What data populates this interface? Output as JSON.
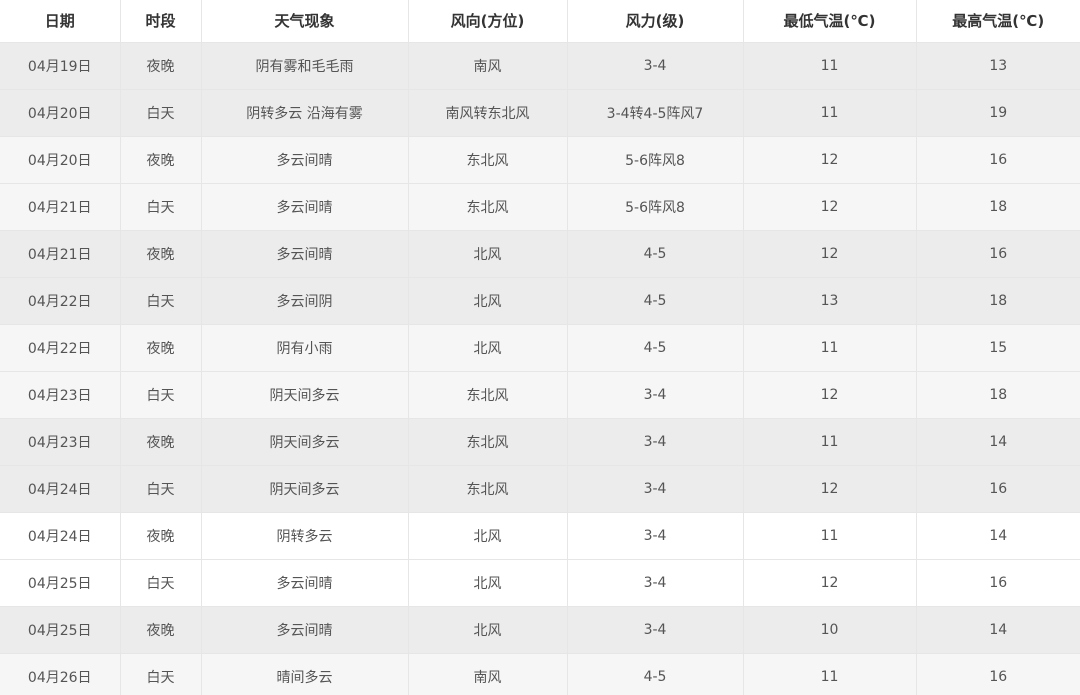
{
  "table": {
    "headers": [
      "日期",
      "时段",
      "天气现象",
      "风向(方位)",
      "风力(级)",
      "最低气温(℃)",
      "最高气温(℃)"
    ],
    "rows": [
      [
        "04月19日",
        "夜晚",
        "阴有雾和毛毛雨",
        "南风",
        "3-4",
        "11",
        "13"
      ],
      [
        "04月20日",
        "白天",
        "阴转多云 沿海有雾",
        "南风转东北风",
        "3-4转4-5阵风7",
        "11",
        "19"
      ],
      [
        "04月20日",
        "夜晚",
        "多云间晴",
        "东北风",
        "5-6阵风8",
        "12",
        "16"
      ],
      [
        "04月21日",
        "白天",
        "多云间晴",
        "东北风",
        "5-6阵风8",
        "12",
        "18"
      ],
      [
        "04月21日",
        "夜晚",
        "多云间晴",
        "北风",
        "4-5",
        "12",
        "16"
      ],
      [
        "04月22日",
        "白天",
        "多云间阴",
        "北风",
        "4-5",
        "13",
        "18"
      ],
      [
        "04月22日",
        "夜晚",
        "阴有小雨",
        "北风",
        "4-5",
        "11",
        "15"
      ],
      [
        "04月23日",
        "白天",
        "阴天间多云",
        "东北风",
        "3-4",
        "12",
        "18"
      ],
      [
        "04月23日",
        "夜晚",
        "阴天间多云",
        "东北风",
        "3-4",
        "11",
        "14"
      ],
      [
        "04月24日",
        "白天",
        "阴天间多云",
        "东北风",
        "3-4",
        "12",
        "16"
      ],
      [
        "04月24日",
        "夜晚",
        "阴转多云",
        "北风",
        "3-4",
        "11",
        "14"
      ],
      [
        "04月25日",
        "白天",
        "多云间晴",
        "北风",
        "3-4",
        "12",
        "16"
      ],
      [
        "04月25日",
        "夜晚",
        "多云间晴",
        "北风",
        "3-4",
        "10",
        "14"
      ],
      [
        "04月26日",
        "白天",
        "晴间多云",
        "南风",
        "4-5",
        "11",
        "16"
      ]
    ]
  }
}
